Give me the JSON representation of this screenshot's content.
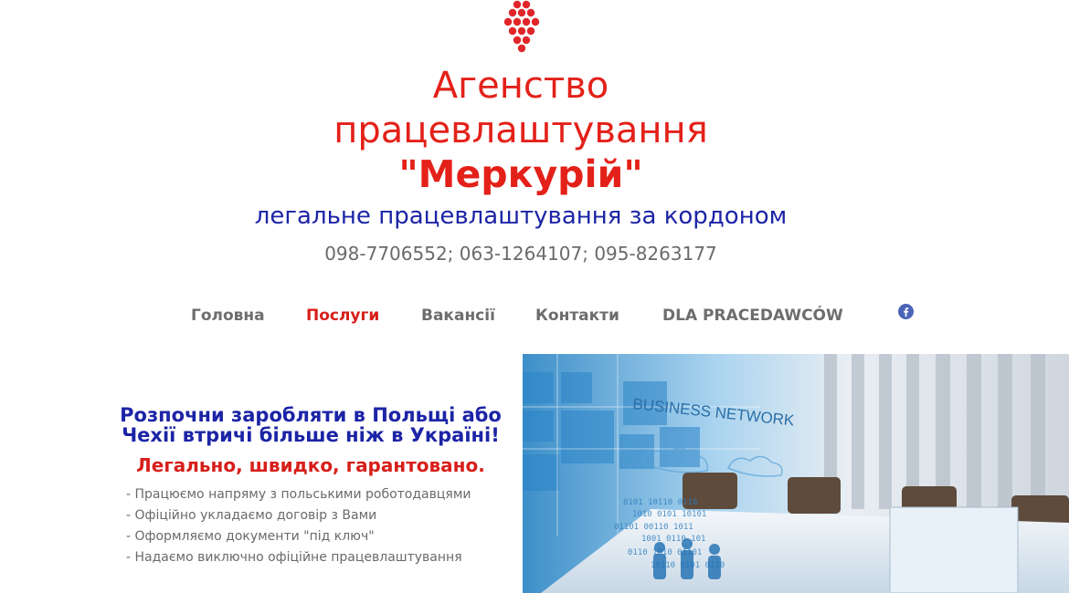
{
  "header": {
    "logo_icon": "red-dots-diamond-logo",
    "title_line1": "Агенство",
    "title_line2": "працевлаштування",
    "title_line3": "\"Меркурій\"",
    "subtitle": "легальне працевлаштування за кордоном",
    "phones": "098-7706552; 063-1264107; 095-8263177"
  },
  "nav": {
    "items": [
      {
        "label": "Головна"
      },
      {
        "label": "Послуги"
      },
      {
        "label": "Вакансії"
      },
      {
        "label": "Контакти"
      },
      {
        "label": "DLA PRACEDAWCÓW"
      }
    ],
    "active_index": 1,
    "social_icon": "facebook-icon"
  },
  "hero": {
    "headline": "Розпочни заробляти в Польщі або Чехії втричі більше ніж в Україні!",
    "tagline": "Легально, швидко, гарантовано.",
    "bullets": [
      "- Працюємо напряму з польськими роботодавцями",
      "- Офіційно укладаємо договір з Вами",
      "- Оформляємо документи \"під ключ\"",
      "- Надаємо виключно офіційне працевлаштування"
    ],
    "image_text": "BUSINESS NETWORK"
  },
  "colors": {
    "brand_red": "#e32119",
    "brand_blue": "#1c24a6",
    "nav_gray": "#6d6d6d",
    "facebook": "#4b64b8"
  }
}
